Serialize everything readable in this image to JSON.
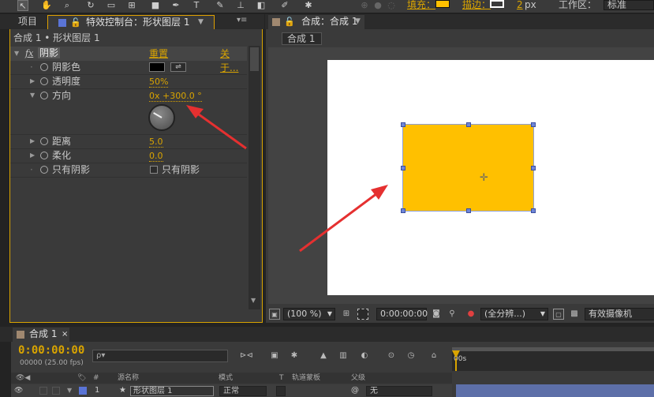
{
  "toolbar": {
    "fill_label": "填充：",
    "stroke_label": "描边：",
    "stroke_width": "2",
    "stroke_unit": "px",
    "workspace_label": "工作区：",
    "workspace_value": "标准",
    "fill_color": "#FFC000",
    "stroke_color": "#FFFFFF"
  },
  "left_panel": {
    "tab_project": "项目",
    "tab_effects": "特效控制台：形状图层 1",
    "breadcrumb": "合成 1 • 形状图层 1",
    "effect": {
      "fx": "fx",
      "name": "阴影",
      "reset": "重置",
      "about": "关于..."
    },
    "properties": [
      {
        "label": "阴影色",
        "color": "#000000"
      },
      {
        "label": "透明度",
        "value": "50%"
      },
      {
        "label": "方向",
        "value": "0x +300.0 °",
        "dial_angle": 300
      },
      {
        "label": "距离",
        "value": "5.0"
      },
      {
        "label": "柔化",
        "value": "0.0"
      },
      {
        "label": "只有阴影",
        "checkbox_label": "只有阴影"
      }
    ]
  },
  "composition": {
    "tab_label": "合成：合成 1",
    "sub_tab": "合成 1",
    "shape_color": "#FFC000",
    "viewer": {
      "zoom": "(100 %)",
      "timecode": "0:00:00:00",
      "resolution": "(全分辨...)",
      "camera": "有效摄像机"
    }
  },
  "timeline": {
    "tab": "合成 1",
    "timecode": "0:00:00:00",
    "fps": "00000 (25.00 fps)",
    "search_placeholder": "ρ▾",
    "ruler_start": "00s",
    "columns": {
      "num": "#",
      "source": "源名称",
      "mode": "模式",
      "t": "T",
      "track": "轨道蒙板",
      "parent": "父级"
    },
    "layer": {
      "num": "1",
      "name": "形状图层 1",
      "mode": "正常",
      "parent": "无"
    }
  }
}
